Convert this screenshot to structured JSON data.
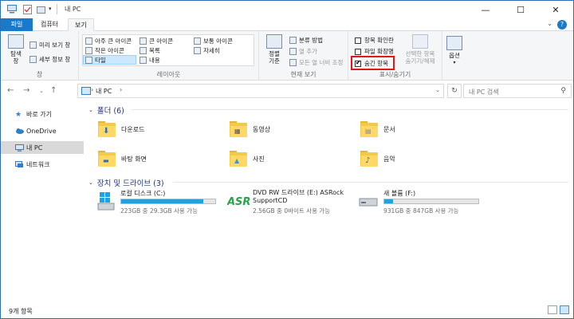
{
  "window": {
    "title": "내 PC",
    "controls": {
      "minimize": "—",
      "maximize": "☐",
      "close": "✕"
    }
  },
  "ribbon_tabs": [
    {
      "label": "파일"
    },
    {
      "label": "컴퓨터"
    },
    {
      "label": "보기"
    }
  ],
  "ribbon": {
    "pane_group": {
      "nav_pane": "탐색\n창",
      "preview_pane": "미리 보기 창",
      "details_pane": "세부 정보 창",
      "label": "창"
    },
    "layout_group": {
      "options": [
        "아주 큰 아이콘",
        "큰 아이콘",
        "보통 아이콘",
        "작은 아이콘",
        "목록",
        "자세히",
        "타일",
        "내용"
      ],
      "selected": "타일",
      "label": "레이아웃"
    },
    "current_view_group": {
      "sort": "정렬\n기준",
      "group_by": "분류 방법",
      "add_column": "열 추가",
      "fit_columns": "모든 열 너비 조정",
      "label": "현재 보기"
    },
    "show_hide_group": {
      "item_checkboxes": "항목 확인란",
      "file_extensions": "파일 확장명",
      "hidden_items": "숨긴 항목",
      "hide_selected": "선택한 항목\n숨기기/해제",
      "label": "표시/숨기기",
      "hidden_items_checked": true
    },
    "options": "옵션"
  },
  "address": {
    "crumbs": [
      "내 PC"
    ],
    "search_placeholder": "내 PC 검색"
  },
  "sidebar": {
    "items": [
      {
        "label": "바로 가기",
        "icon": "star-icon"
      },
      {
        "label": "OneDrive",
        "icon": "cloud-icon"
      },
      {
        "label": "내 PC",
        "icon": "computer-icon",
        "selected": true
      },
      {
        "label": "네트워크",
        "icon": "network-icon"
      }
    ]
  },
  "folders_section": {
    "title": "폴더 (6)",
    "items": [
      {
        "label": "다운로드",
        "icon": "download-folder-icon"
      },
      {
        "label": "동영상",
        "icon": "videos-folder-icon"
      },
      {
        "label": "문서",
        "icon": "documents-folder-icon"
      },
      {
        "label": "바탕 화면",
        "icon": "desktop-folder-icon"
      },
      {
        "label": "사진",
        "icon": "pictures-folder-icon"
      },
      {
        "label": "음악",
        "icon": "music-folder-icon"
      }
    ]
  },
  "drives_section": {
    "title": "장치 및 드라이브 (3)",
    "items": [
      {
        "name": "로컬 디스크 (C:)",
        "free": "223GB 중 29.3GB 사용 가능",
        "used_fraction": 0.87,
        "icon": "windows-drive-icon"
      },
      {
        "name": "DVD RW 드라이브 (E:) ASRock SupportCD",
        "free": "2.56GB 중 0바이트 사용 가능",
        "icon": "asrock-disc-icon"
      },
      {
        "name": "새 볼륨 (F:)",
        "free": "931GB 중 847GB 사용 가능",
        "used_fraction": 0.09,
        "icon": "hard-drive-icon"
      }
    ]
  },
  "status": {
    "count": "9개 항목"
  },
  "colors": {
    "accent": "#1979ca",
    "bar_fill": "#26a0da",
    "highlight": "#e01818"
  }
}
